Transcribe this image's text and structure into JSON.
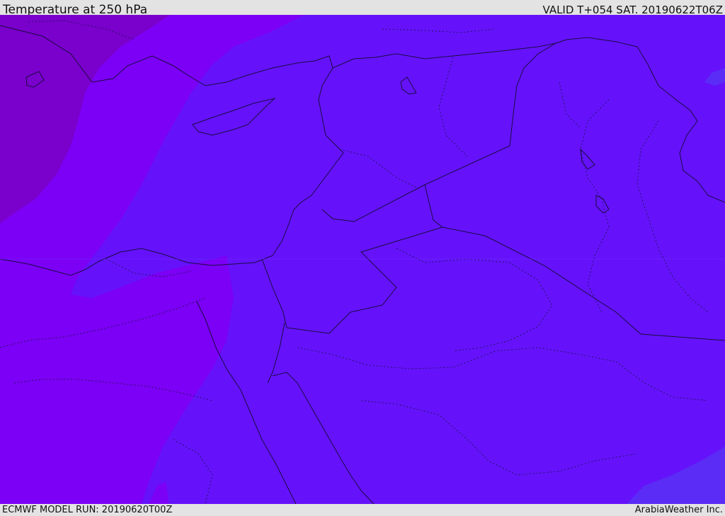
{
  "header": {
    "title": "Temperature at 250 hPa",
    "valid": "VALID T+054 SAT. 20190622T06Z"
  },
  "footer": {
    "model_run": "ECMWF MODEL RUN: 20190620T00Z",
    "credit": "ArabiaWeather Inc."
  },
  "map": {
    "region": "Eastern Mediterranean and Middle East",
    "colors": {
      "coldest": "#7a00cc",
      "colder": "#7c00f5",
      "cold": "#6512fb",
      "warm_patch": "#5a2cf5",
      "border_line": "#1a0b40",
      "boundary_dots": "#2a1060"
    }
  }
}
